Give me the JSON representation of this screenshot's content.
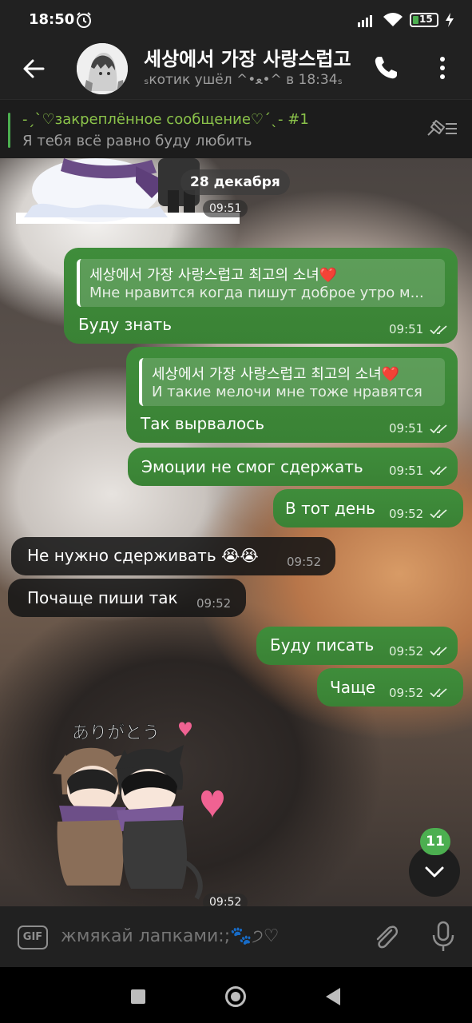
{
  "status_bar": {
    "time": "18:50",
    "battery": "15"
  },
  "header": {
    "title": "세상에서 가장 사랑스럽고",
    "status": "ₛкотик ушёл ^•ﻌ•^ в 18:34ₛ"
  },
  "pinned": {
    "title": "-ˏˋ♡закреплённое сообщение♡ˊˎ- #1",
    "text": "Я тебя всё равно буду любить"
  },
  "chat": {
    "date": "28 декабря",
    "sticker_top_time": "09:51",
    "messages": [
      {
        "reply_title": "세상에서 가장 사랑스럽고 최고의 소녀❤️",
        "reply_text": "Мне нравится когда пишут доброе утро м...",
        "text": "Буду знать",
        "time": "09:51"
      },
      {
        "reply_title": "세상에서 가장 사랑스럽고 최고의 소녀❤️",
        "reply_text": "И такие мелочи мне тоже нравятся",
        "text": "Так вырвалось",
        "time": "09:51"
      },
      {
        "text": "Эмоции не смог сдержать",
        "time": "09:51"
      },
      {
        "text": "В тот день",
        "time": "09:52"
      },
      {
        "text": "Не нужно сдерживать 😭😭",
        "time": "09:52"
      },
      {
        "text": "Почаще пиши так",
        "time": "09:52"
      },
      {
        "text": "Буду писать",
        "time": "09:52"
      },
      {
        "text": "Чаще",
        "time": "09:52"
      }
    ],
    "sticker_bottom_caption": "ありがとう",
    "sticker_bottom_time": "09:52",
    "unread_count": "11"
  },
  "composer": {
    "placeholder": "жмякай лапками:;🐾੭♡"
  },
  "colors": {
    "accent": "#4caf50",
    "outgoing_bubble": "#3f8a3a",
    "incoming_bubble": "#161616"
  },
  "icons": [
    "alarm-icon",
    "signal-icon",
    "wifi-icon",
    "battery-icon",
    "charging-icon",
    "back-arrow-icon",
    "phone-icon",
    "more-vert-icon",
    "pinned-list-icon",
    "double-check-icon",
    "chevron-down-icon",
    "gif-icon",
    "paperclip-icon",
    "mic-icon"
  ]
}
